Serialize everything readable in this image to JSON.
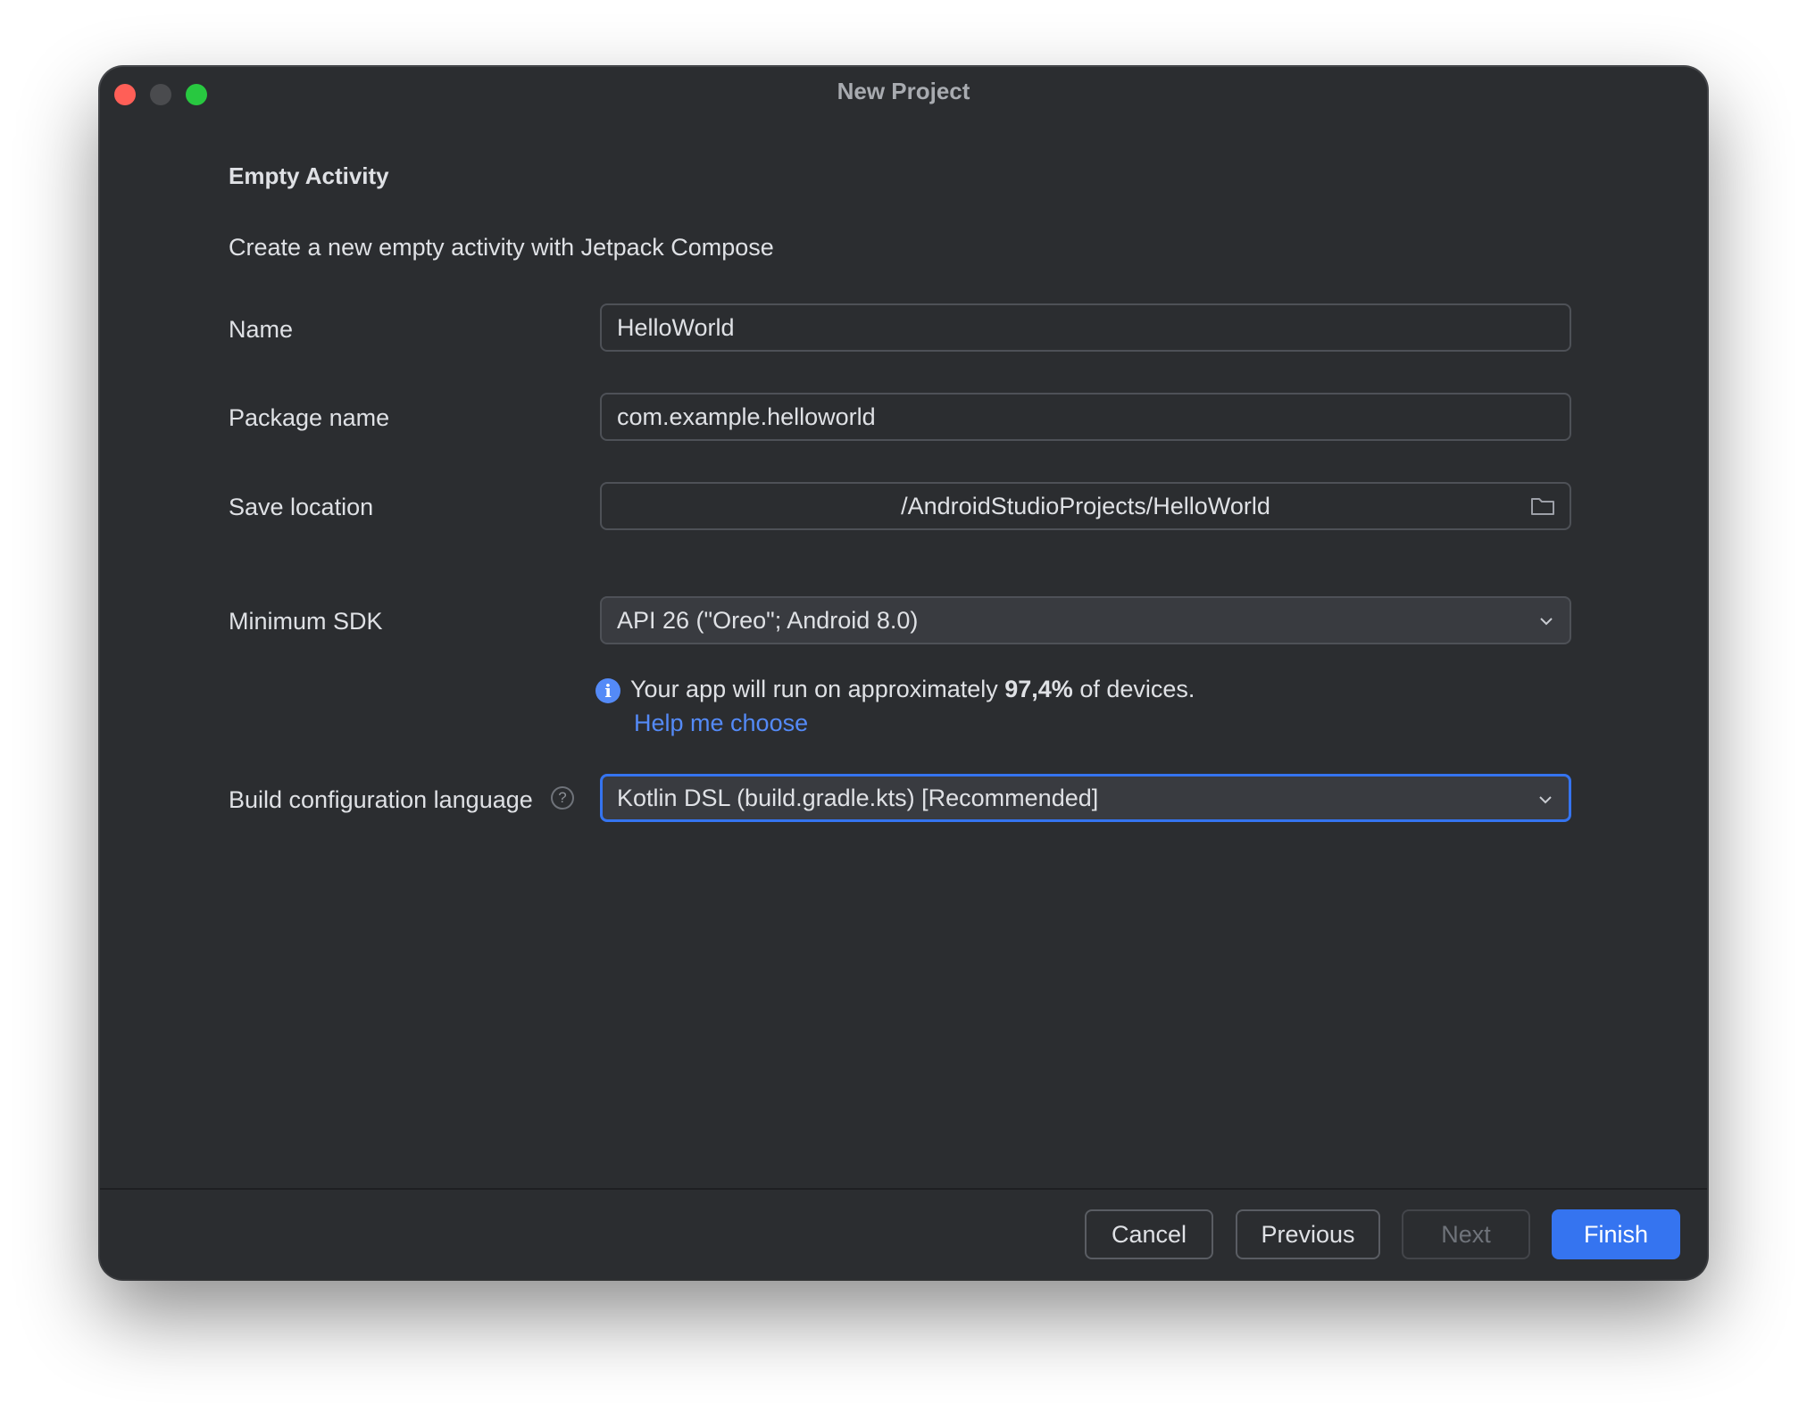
{
  "window": {
    "title": "New Project"
  },
  "page": {
    "heading": "Empty Activity",
    "description": "Create a new empty activity with Jetpack Compose"
  },
  "form": {
    "name": {
      "label": "Name",
      "value": "HelloWorld"
    },
    "package_name": {
      "label": "Package name",
      "value": "com.example.helloworld"
    },
    "save_location": {
      "label": "Save location",
      "value": "/AndroidStudioProjects/HelloWorld",
      "icon": "folder-icon"
    },
    "minimum_sdk": {
      "label": "Minimum SDK",
      "selected": "API 26 (\"Oreo\"; Android 8.0)",
      "icon": "chevron-down-icon"
    },
    "sdk_info": {
      "icon": "info-icon",
      "text_before": "Your app will run on approximately ",
      "percentage": "97,4%",
      "text_after": " of devices.",
      "help_link": "Help me choose"
    },
    "build_config_language": {
      "label": "Build configuration language",
      "help_icon": "question-circle-icon",
      "selected": "Kotlin DSL (build.gradle.kts) [Recommended]",
      "icon": "chevron-down-icon"
    }
  },
  "footer": {
    "cancel_label": "Cancel",
    "previous_label": "Previous",
    "next_label": "Next",
    "finish_label": "Finish"
  },
  "colors": {
    "window_bg": "#2b2d30",
    "accent": "#3574f0",
    "link": "#548af7",
    "text": "#dfe1e5",
    "close": "#ff5f57",
    "maximize": "#28c840"
  }
}
